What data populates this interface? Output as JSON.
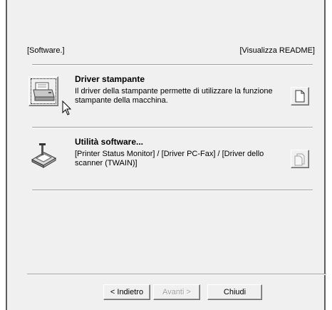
{
  "header": {
    "left_label": "[Software.]",
    "right_label": "[Visualizza README]"
  },
  "items": [
    {
      "title": "Driver stampante",
      "description_line1": "Il driver della stampante permette di utilizzare la funzione",
      "description_line2": "stampante della macchina."
    },
    {
      "title": "Utilità software...",
      "description_line1": "[Printer Status Monitor] / [Driver PC-Fax] / [Driver dello",
      "description_line2": "scanner (TWAIN)]"
    }
  ],
  "buttons": {
    "back": "< Indietro",
    "next": "Avanti >",
    "close": "Chiudi"
  },
  "icons": {
    "item1": "printer-icon",
    "item2": "scanner-tools-icon",
    "readme1": "document-icon",
    "readme2": "document-icon-disabled"
  }
}
